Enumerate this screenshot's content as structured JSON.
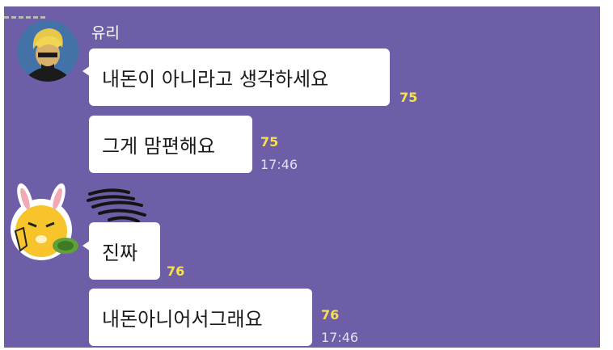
{
  "colors": {
    "background": "#6e5ea8",
    "bubble": "#ffffff",
    "unread": "#f6e04b",
    "time": "#e3dff0"
  },
  "messages": [
    {
      "sender": "유리",
      "text": "내돈이 아니라고 생각하세요",
      "unread": "75"
    },
    {
      "text": "그게 맘편해요",
      "unread": "75",
      "time": "17:46"
    },
    {
      "text": "진짜",
      "unread": "76"
    },
    {
      "text": "내돈아니어서그래요",
      "unread": "76",
      "time": "17:46"
    }
  ],
  "avatars": [
    "user-avatar-yuri",
    "user-avatar-rabbit"
  ]
}
